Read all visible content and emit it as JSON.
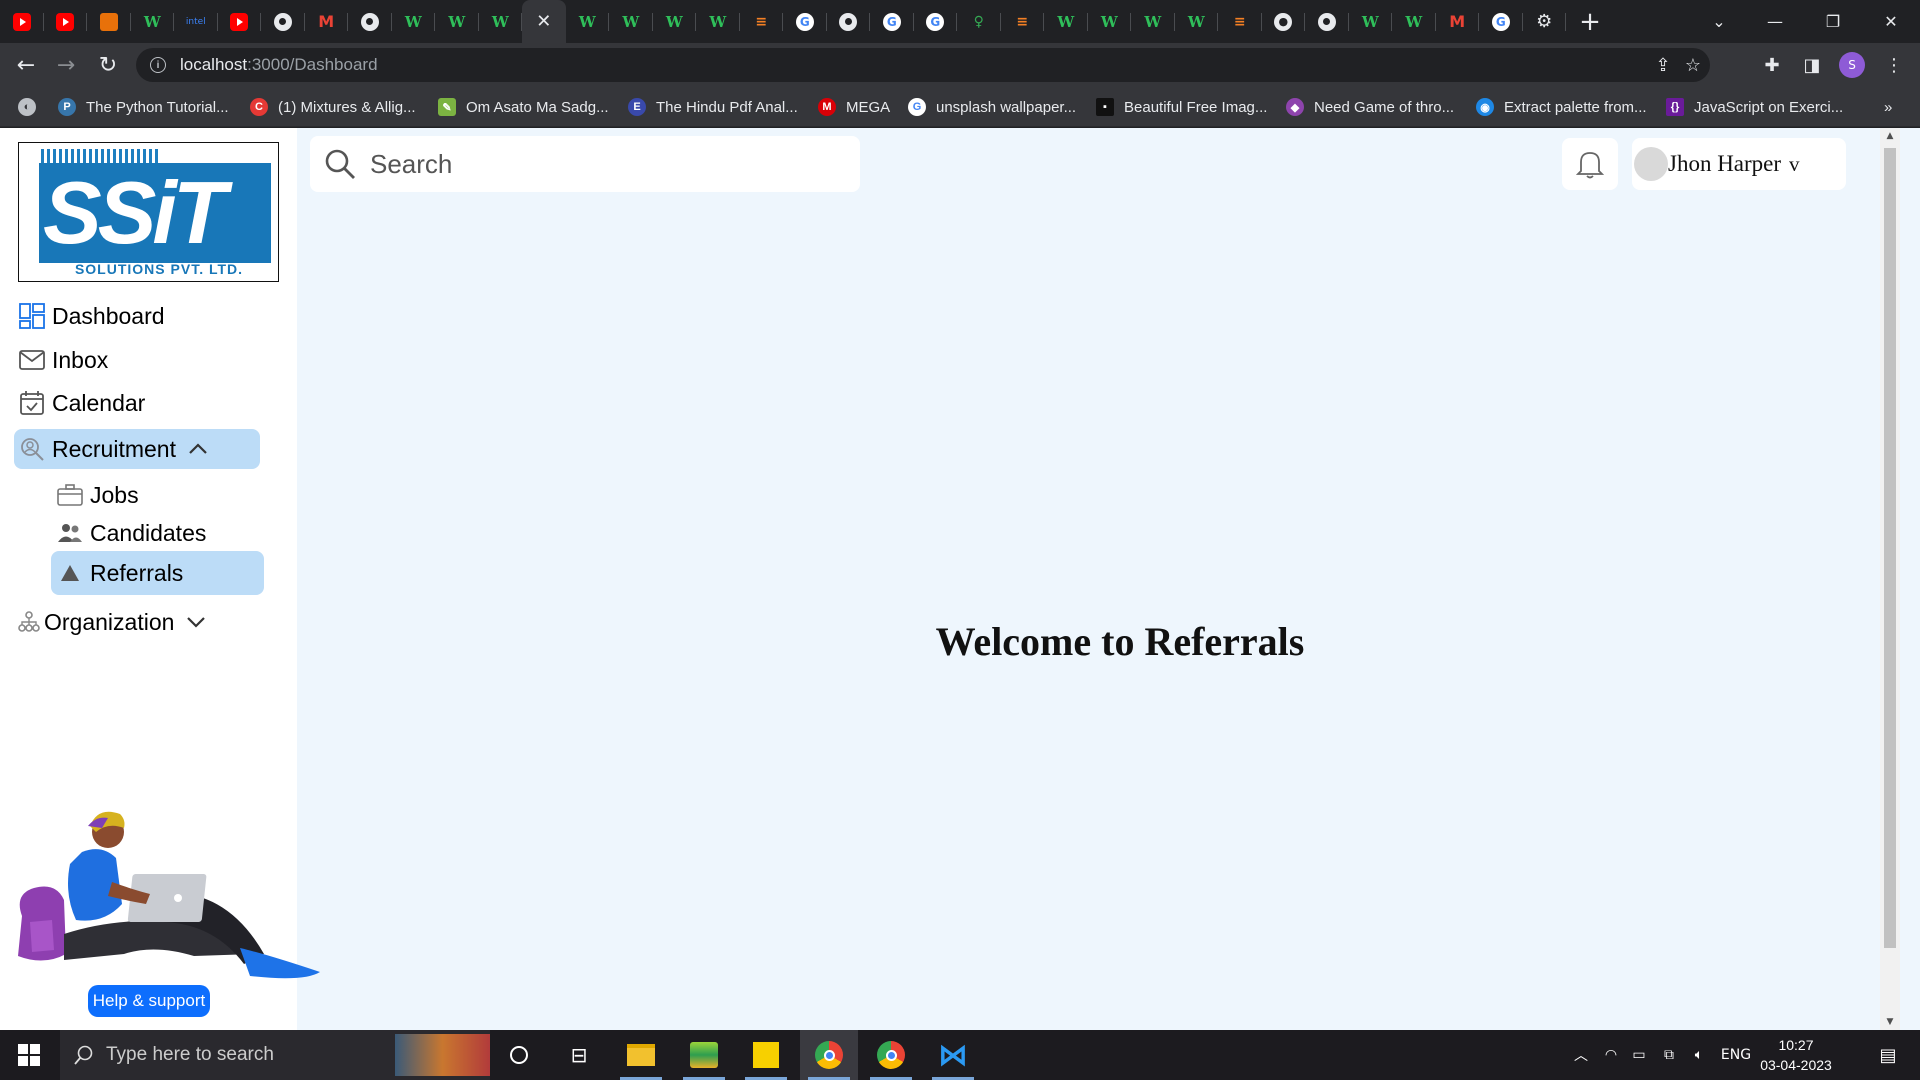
{
  "browser": {
    "tabs": [
      {
        "icon": "youtube-icon"
      },
      {
        "icon": "youtube-icon"
      },
      {
        "icon": "gift-icon"
      },
      {
        "icon": "w-icon"
      },
      {
        "icon": "intel-icon",
        "glyph": "intel"
      },
      {
        "icon": "youtube-icon"
      },
      {
        "icon": "chrome-icon"
      },
      {
        "icon": "gmail-icon"
      },
      {
        "icon": "chrome-icon"
      },
      {
        "icon": "w-icon"
      },
      {
        "icon": "w-icon"
      },
      {
        "icon": "w-icon"
      }
    ],
    "active_close": "✕",
    "tabs_after": [
      {
        "icon": "w-icon"
      },
      {
        "icon": "w-icon"
      },
      {
        "icon": "w-icon"
      },
      {
        "icon": "w-icon"
      },
      {
        "icon": "stackoverflow-icon"
      },
      {
        "icon": "google-icon"
      },
      {
        "icon": "chrome-icon"
      },
      {
        "icon": "google-icon"
      },
      {
        "icon": "google-icon"
      },
      {
        "icon": "bulb-icon"
      },
      {
        "icon": "stackoverflow-icon"
      },
      {
        "icon": "w-icon"
      },
      {
        "icon": "w-icon"
      },
      {
        "icon": "w-icon"
      },
      {
        "icon": "w-icon"
      },
      {
        "icon": "stackoverflow-icon"
      },
      {
        "icon": "github-icon"
      },
      {
        "icon": "chrome-icon"
      },
      {
        "icon": "w-icon"
      },
      {
        "icon": "w-icon"
      },
      {
        "icon": "gmail-icon"
      },
      {
        "icon": "google-icon"
      },
      {
        "icon": "gear-icon"
      }
    ],
    "url_host": "localhost",
    "url_path": ":3000/Dashboard",
    "profile_initial": "S",
    "bookmarks": [
      {
        "label": "The Python Tutorial...",
        "color": "#3776ab"
      },
      {
        "label": "(1) Mixtures & Allig...",
        "color": "#e53935"
      },
      {
        "label": "Om Asato Ma Sadg...",
        "color": "#7cb342"
      },
      {
        "label": "The Hindu Pdf Anal...",
        "color": "#3949ab",
        "glyph": "E"
      },
      {
        "label": "MEGA",
        "color": "#d90007",
        "glyph": "M"
      },
      {
        "label": "unsplash wallpaper...",
        "color": "#ffffff",
        "glyph": "G"
      },
      {
        "label": "Beautiful Free Imag...",
        "color": "#111111"
      },
      {
        "label": "Need Game of thro...",
        "color": "#8e44ad"
      },
      {
        "label": "Extract palette from...",
        "color": "#1e88e5"
      },
      {
        "label": "JavaScript on Exerci...",
        "color": "#6a1b9a"
      }
    ],
    "bookmarks_more": "»"
  },
  "app": {
    "logo": {
      "brand": "SSiT",
      "subtitle": "SOLUTIONS PVT. LTD."
    },
    "sidebar": {
      "items": [
        {
          "label": "Dashboard",
          "icon": "dashboard-icon"
        },
        {
          "label": "Inbox",
          "icon": "mail-icon"
        },
        {
          "label": "Calendar",
          "icon": "calendar-icon"
        },
        {
          "label": "Recruitment",
          "icon": "recruitment-icon",
          "expanded": true
        }
      ],
      "sub_items": [
        {
          "label": "Jobs",
          "icon": "briefcase-icon"
        },
        {
          "label": "Candidates",
          "icon": "people-icon"
        },
        {
          "label": "Referrals",
          "icon": "triangle-icon",
          "selected": true
        }
      ],
      "org": {
        "label": "Organization",
        "icon": "org-chart-icon"
      },
      "help_label": "Help & support"
    },
    "header": {
      "search_placeholder": "Search",
      "user_name": "Jhon Harper",
      "user_caret": "v"
    },
    "main": {
      "welcome": "Welcome to Referrals"
    },
    "accent": "#bcdcf7",
    "background": "#eef6fd"
  },
  "taskbar": {
    "search_placeholder": "Type here to search",
    "language": "ENG",
    "time": "10:27",
    "date": "03-04-2023"
  }
}
